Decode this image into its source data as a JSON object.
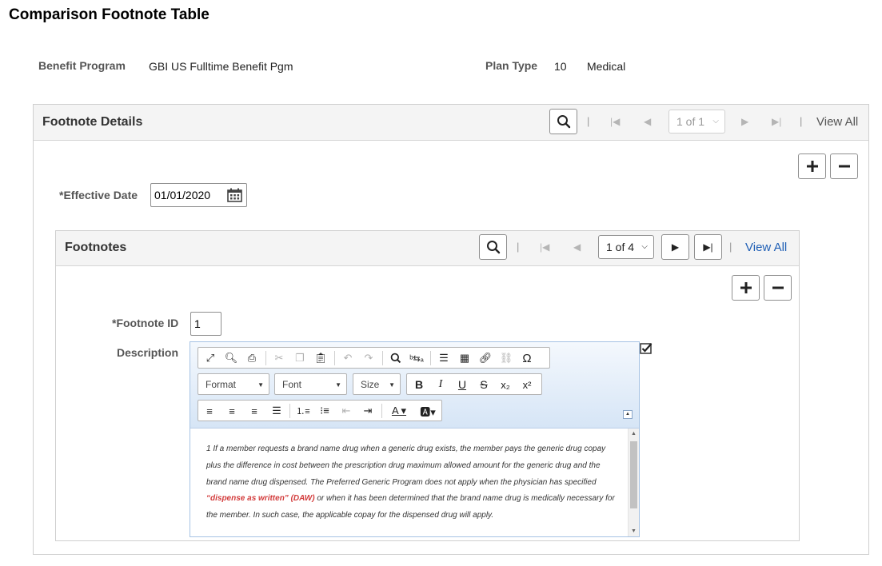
{
  "page": {
    "title": "Comparison Footnote Table"
  },
  "header_fields": {
    "benefit_program_label": "Benefit Program",
    "benefit_program_value": "GBI US Fulltime Benefit Pgm",
    "plan_type_label": "Plan Type",
    "plan_type_code": "10",
    "plan_type_name": "Medical"
  },
  "footnote_details": {
    "title": "Footnote Details",
    "pager": "1 of 1",
    "view_all": "View All",
    "effective_date_label": "*Effective Date",
    "effective_date_value": "01/01/2020"
  },
  "footnotes": {
    "title": "Footnotes",
    "pager": "1 of 4",
    "view_all": "View All",
    "footnote_id_label": "*Footnote ID",
    "footnote_id_value": "1",
    "description_label": "Description"
  },
  "editor": {
    "format_label": "Format",
    "font_label": "Font",
    "size_label": "Size",
    "content": {
      "part1": "1 If a member requests a brand name drug when a generic drug exists, the member pays the generic drug copay plus the difference in cost between the prescription drug maximum allowed amount for the generic drug and the brand name drug dispensed. The Preferred Generic Program does not apply when the physician has specified ",
      "highlight": "“dispense as written” (DAW)",
      "part2": " or when it has been determined that the brand name drug is medically necessary for the member. In such case, the applicable copay for the dispensed drug will apply."
    }
  },
  "colors": {
    "link": "#1f5fb5",
    "highlight_text": "#d33c3c",
    "editor_border": "#a6c3e4"
  },
  "icons": [
    "search-icon",
    "first-page-icon",
    "previous-page-icon",
    "next-page-icon",
    "last-page-icon",
    "add-row-icon",
    "delete-row-icon",
    "calendar-icon",
    "spell-check-icon"
  ]
}
